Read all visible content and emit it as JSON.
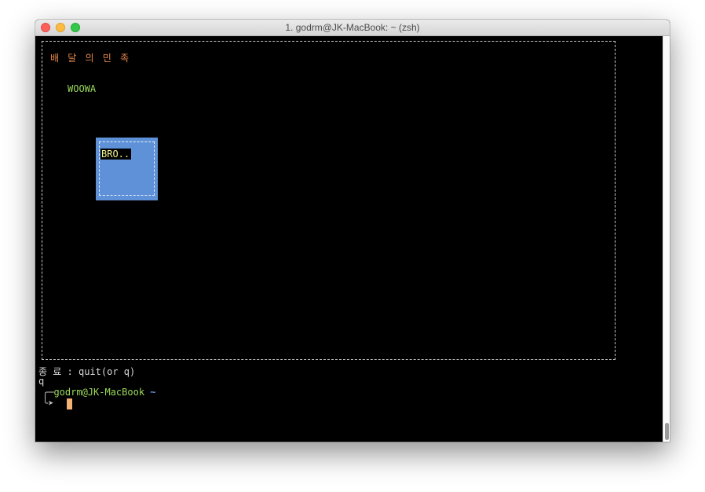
{
  "window": {
    "title": "1. godrm@JK-MacBook: ~ (zsh)"
  },
  "app": {
    "title": "배 달 의 민 족",
    "label": "WOOWA",
    "box_label": "BRO.."
  },
  "terminal": {
    "quit_hint": "종 료 : quit(or q)",
    "input_line": "q",
    "prompt_prefix": "╭─",
    "prompt_user_host": "godrm@JK-MacBook",
    "prompt_dir": "~",
    "prompt_arrow": "╰➤"
  },
  "colors": {
    "title_orange": "#e8864d",
    "green": "#9bd95a",
    "box_blue": "#5e91d8",
    "label_yellow": "#f2f28c",
    "cursor": "#f2b276"
  }
}
